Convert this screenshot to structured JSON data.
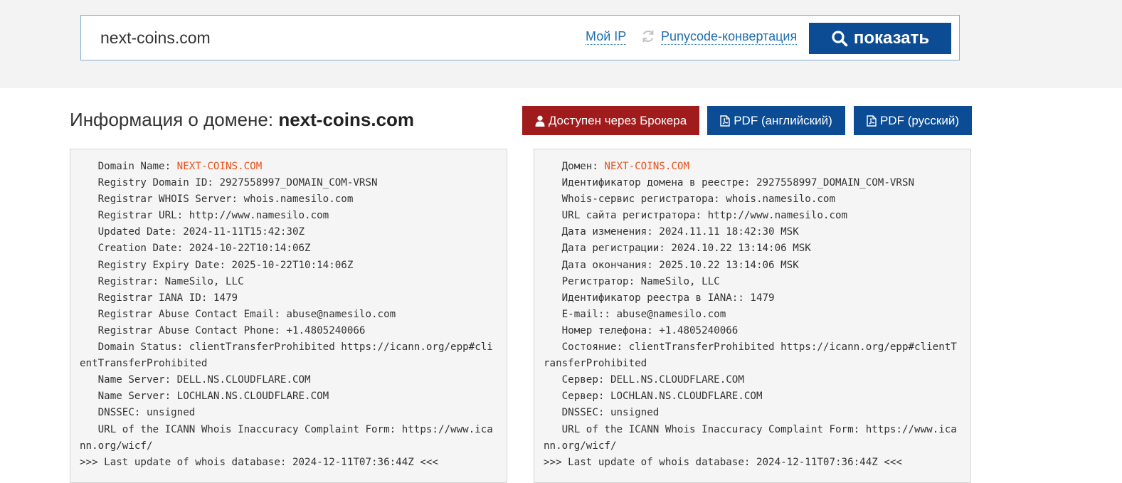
{
  "search": {
    "value": "next-coins.com",
    "my_ip_label": "Мой IP",
    "punycode_label": "Punycode-конвертация",
    "show_button_label": "показать"
  },
  "header": {
    "title_prefix": "Информация о домене:",
    "title_domain": "next-coins.com"
  },
  "actions": {
    "broker_label": "Доступен через Брокера",
    "pdf_en_label": "PDF (английский)",
    "pdf_ru_label": "PDF (русский)"
  },
  "colors": {
    "primary": "#0b4c94",
    "broker": "#a01b1b",
    "highlight": "#e8501a",
    "link": "#1f6fb0"
  },
  "whois_en": {
    "domain_label": "   Domain Name: ",
    "domain_value": "NEXT-COINS.COM",
    "lines": [
      "   Registry Domain ID: 2927558997_DOMAIN_COM-VRSN",
      "   Registrar WHOIS Server: whois.namesilo.com",
      "   Registrar URL: http://www.namesilo.com",
      "   Updated Date: 2024-11-11T15:42:30Z",
      "   Creation Date: 2024-10-22T10:14:06Z",
      "   Registry Expiry Date: 2025-10-22T10:14:06Z",
      "   Registrar: NameSilo, LLC",
      "   Registrar IANA ID: 1479",
      "   Registrar Abuse Contact Email: abuse@namesilo.com",
      "   Registrar Abuse Contact Phone: +1.4805240066",
      "   Domain Status: clientTransferProhibited https://icann.org/epp#clientTransferProhibited",
      "   Name Server: DELL.NS.CLOUDFLARE.COM",
      "   Name Server: LOCHLAN.NS.CLOUDFLARE.COM",
      "   DNSSEC: unsigned",
      "   URL of the ICANN Whois Inaccuracy Complaint Form: https://www.icann.org/wicf/",
      ">>> Last update of whois database: 2024-12-11T07:36:44Z <<<"
    ]
  },
  "whois_ru": {
    "domain_label": "   Домен: ",
    "domain_value": "NEXT-COINS.COM",
    "lines": [
      "   Идентификатор домена в реестре: 2927558997_DOMAIN_COM-VRSN",
      "   Whois-сервис регистратора: whois.namesilo.com",
      "   URL сайта регистратора: http://www.namesilo.com",
      "   Дата изменения: 2024.11.11 18:42:30 MSK",
      "   Дата регистрации: 2024.10.22 13:14:06 MSK",
      "   Дата окончания: 2025.10.22 13:14:06 MSK",
      "   Регистратор: NameSilo, LLC",
      "   Идентификатор реестра в IANA:: 1479",
      "   E-mail:: abuse@namesilo.com",
      "   Номер телефона: +1.4805240066",
      "   Состояние: clientTransferProhibited https://icann.org/epp#clientTransferProhibited",
      "   Сервер: DELL.NS.CLOUDFLARE.COM",
      "   Сервер: LOCHLAN.NS.CLOUDFLARE.COM",
      "   DNSSEC: unsigned",
      "   URL of the ICANN Whois Inaccuracy Complaint Form: https://www.icann.org/wicf/",
      ">>> Last update of whois database: 2024-12-11T07:36:44Z <<<"
    ]
  }
}
